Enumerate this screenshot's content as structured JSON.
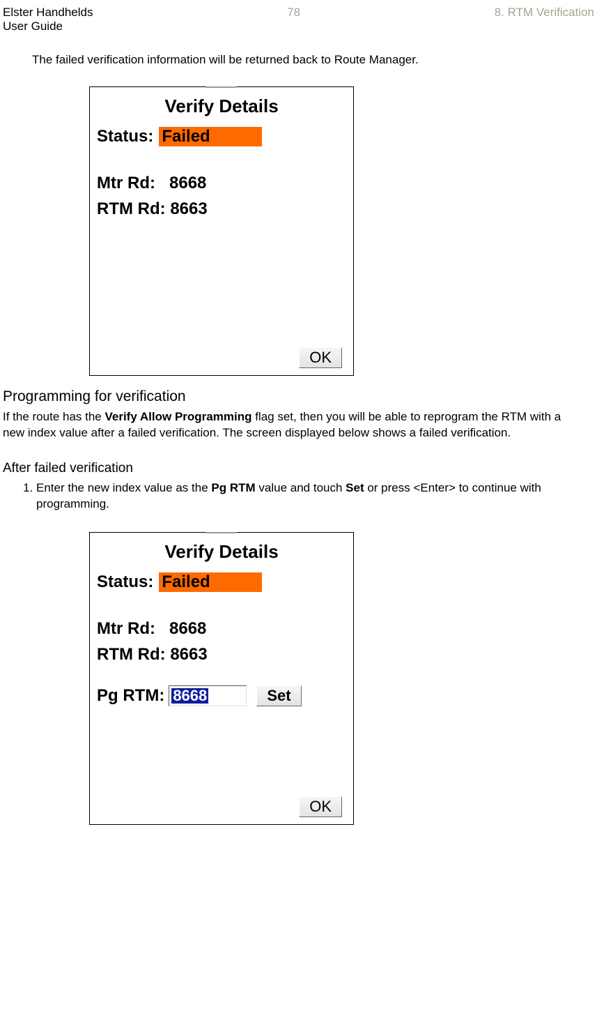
{
  "header": {
    "left_line1": "Elster Handhelds",
    "left_line2": "User Guide",
    "page_number": "78",
    "chapter": "8. RTM Verification"
  },
  "intro": "The failed verification information will be returned back to Route Manager.",
  "screen1": {
    "title": "Verify Details",
    "status_label": "Status:",
    "status_value": "Failed",
    "mtr_label": "Mtr Rd:",
    "mtr_value": "8668",
    "rtm_label": "RTM Rd:",
    "rtm_value": "8663",
    "ok_label": "OK"
  },
  "section": {
    "title": "Programming for verification",
    "text_pre": "If the route has the ",
    "flag_name": "Verify Allow Programming",
    "text_post": " flag set, then you will be able to reprogram the RTM with a new index value after a failed verification. The screen displayed below shows a failed verification."
  },
  "sub": {
    "title": "After failed verification",
    "step1_pre": "Enter the new index value as the ",
    "step1_bold1": "Pg RTM",
    "step1_mid": " value and touch ",
    "step1_bold2": "Set",
    "step1_post": " or press <Enter> to continue with programming."
  },
  "screen2": {
    "title": "Verify Details",
    "status_label": "Status:",
    "status_value": "Failed",
    "mtr_label": "Mtr Rd:",
    "mtr_value": "8668",
    "rtm_label": "RTM Rd:",
    "rtm_value": "8663",
    "pg_label": "Pg RTM:",
    "pg_value": "8668",
    "set_label": "Set",
    "ok_label": "OK"
  }
}
